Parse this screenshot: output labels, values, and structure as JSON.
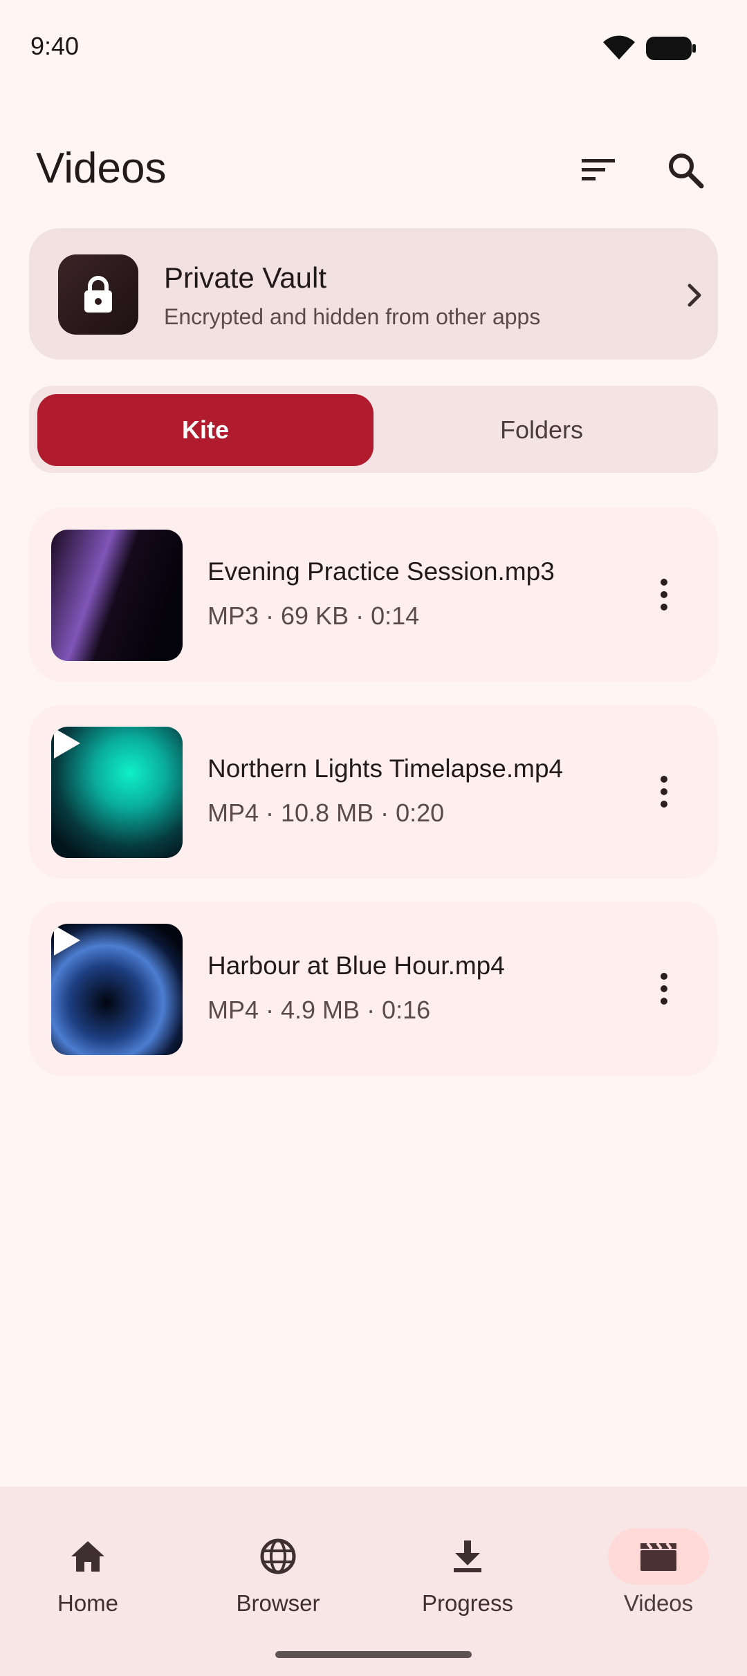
{
  "status_bar": {
    "time": "9:40",
    "wifi_icon": "wifi-icon",
    "battery_icon": "battery-icon"
  },
  "header": {
    "title": "Videos",
    "sort_icon": "sort-icon",
    "search_icon": "search-icon"
  },
  "vault": {
    "title": "Private Vault",
    "subtitle": "Encrypted and hidden from other apps",
    "icon": "lock-icon",
    "chevron": "chevron-right-icon"
  },
  "tabs": [
    {
      "label": "Kite",
      "selected": true
    },
    {
      "label": "Folders",
      "selected": false
    }
  ],
  "media": [
    {
      "name": "Evening Practice Session.mp3",
      "meta": "MP3 · 69 KB · 0:14",
      "type": "audio"
    },
    {
      "name": "Northern Lights Timelapse.mp4",
      "meta": "MP4 · 10.8 MB · 0:20",
      "type": "video"
    },
    {
      "name": "Harbour at Blue Hour.mp4",
      "meta": "MP4 · 4.9 MB · 0:16",
      "type": "video"
    }
  ],
  "bottom_nav": [
    {
      "label": "Home",
      "icon": "home-icon",
      "active": false
    },
    {
      "label": "Browser",
      "icon": "globe-icon",
      "active": false
    },
    {
      "label": "Progress",
      "icon": "download-icon",
      "active": false
    },
    {
      "label": "Videos",
      "icon": "clapperboard-icon",
      "active": true
    }
  ],
  "colors": {
    "background": "#FFF6F4",
    "accent": "#B01C2E",
    "card": "#FFEEEE",
    "vault_card": "#F1E1E0",
    "nav_active_pill": "#FFDAD8"
  }
}
